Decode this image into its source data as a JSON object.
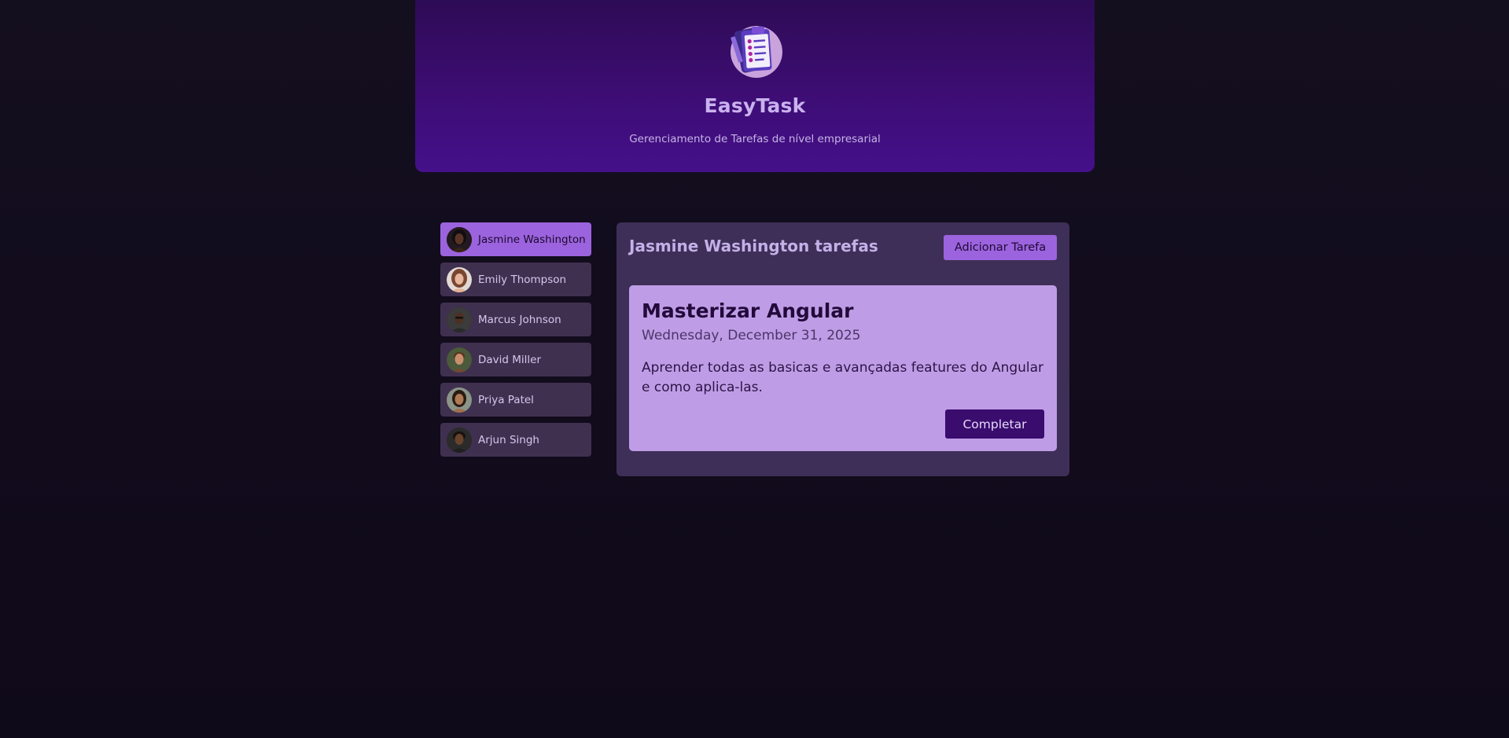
{
  "header": {
    "logo_icon": "clipboard-checklist-icon",
    "title": "EasyTask",
    "subtitle": "Gerenciamento de Tarefas de nível empresarial"
  },
  "users": [
    {
      "name": "Jasmine Washington",
      "selected": true
    },
    {
      "name": "Emily Thompson",
      "selected": false
    },
    {
      "name": "Marcus Johnson",
      "selected": false
    },
    {
      "name": "David Miller",
      "selected": false
    },
    {
      "name": "Priya Patel",
      "selected": false
    },
    {
      "name": "Arjun Singh",
      "selected": false
    }
  ],
  "tasks_panel": {
    "title": "Jasmine Washington tarefas",
    "add_button_label": "Adicionar Tarefa",
    "tasks": [
      {
        "title": "Masterizar Angular",
        "date": "Wednesday, December 31, 2025",
        "description": "Aprender todas as basicas e avançadas features do Angular e como aplica-las.",
        "complete_button_label": "Completar"
      }
    ]
  },
  "colors": {
    "background": "#120c1d",
    "header": "#3d0d74",
    "accent": "#9c63de",
    "panel": "#3e2f58",
    "card": "#bf9de6",
    "button_dark": "#3a0c6e"
  }
}
